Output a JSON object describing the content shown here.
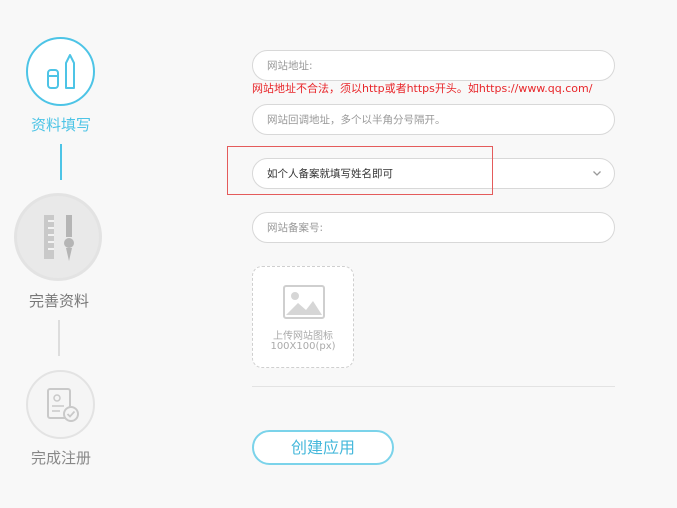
{
  "steps": [
    {
      "label": "资料填写",
      "icon": "pen-ruler-icon"
    },
    {
      "label": "完善资料",
      "icon": "ruler-pencil-icon"
    },
    {
      "label": "完成注册",
      "icon": "document-check-icon"
    }
  ],
  "form": {
    "url_placeholder": "网站地址:",
    "url_error": "网站地址不合法，须以http或者https开头。如https://www.qq.com/",
    "callback_placeholder": "网站回调地址，多个以半角分号隔开。",
    "type_value": "如个人备案就填写姓名即可",
    "icp_placeholder": "网站备案号:",
    "upload_line1": "上传网站图标",
    "upload_line2": "100X100(px)",
    "submit_label": "创建应用"
  },
  "colors": {
    "accent": "#4dc4e6",
    "error": "#e8262a",
    "highlight": "#e45b5b"
  }
}
